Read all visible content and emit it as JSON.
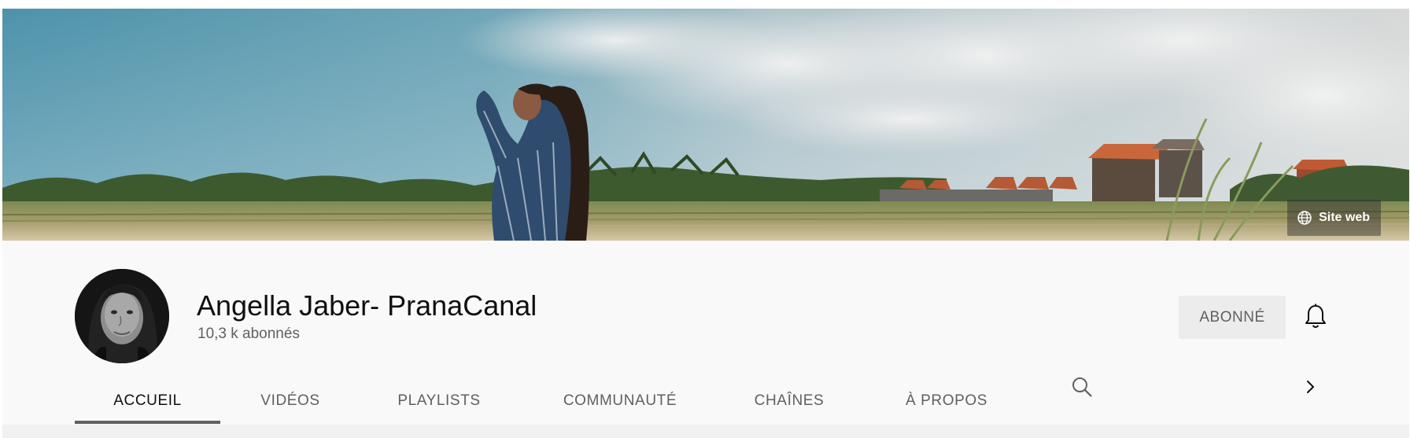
{
  "banner": {
    "site_link_label": "Site web",
    "site_link_icon": "globe-icon"
  },
  "channel": {
    "name": "Angella Jaber- PranaCanal",
    "subscribers": "10,3 k abonnés",
    "subscribe_label": "ABONNÉ",
    "bell_icon": "bell-icon"
  },
  "tabs": {
    "items": [
      {
        "label": "ACCUEIL",
        "active": true
      },
      {
        "label": "VIDÉOS",
        "active": false
      },
      {
        "label": "PLAYLISTS",
        "active": false
      },
      {
        "label": "COMMUNAUTÉ",
        "active": false
      },
      {
        "label": "CHAÎNES",
        "active": false
      },
      {
        "label": "À PROPOS",
        "active": false
      }
    ],
    "search_icon": "search-icon",
    "next_icon": "chevron-right-icon"
  },
  "colors": {
    "header_bg": "#f9f9f9",
    "text_primary": "#0f0f0f",
    "text_secondary": "#606060",
    "subscribe_bg": "#ececec"
  }
}
